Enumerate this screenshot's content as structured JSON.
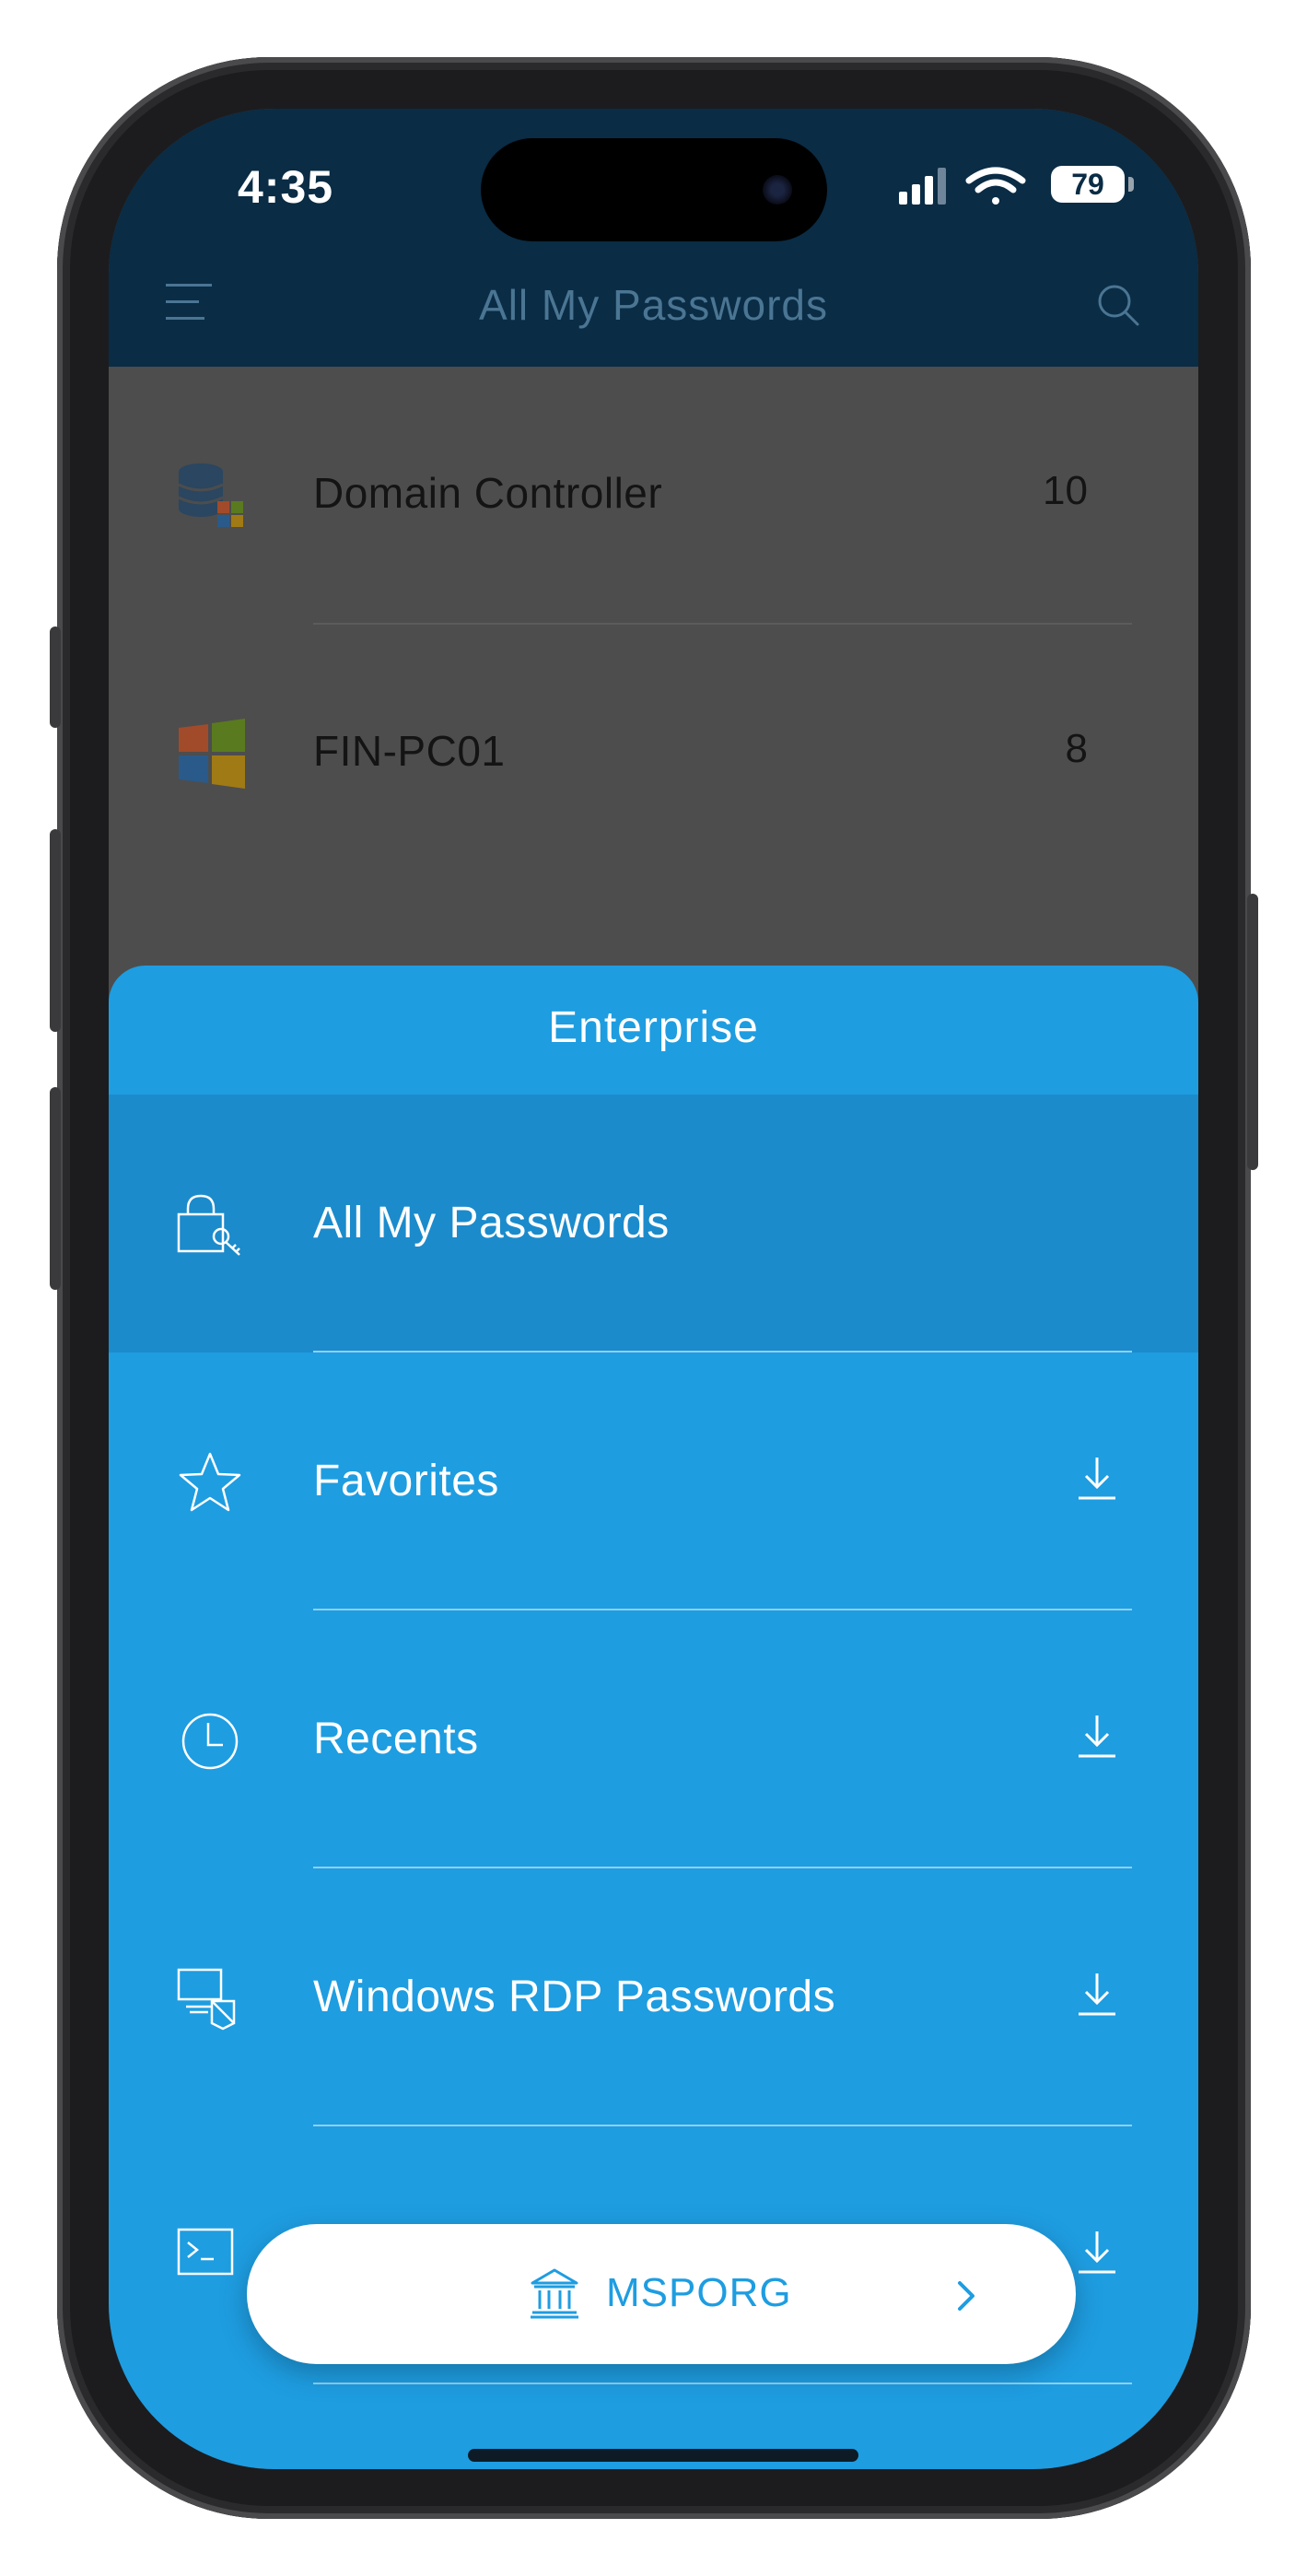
{
  "status_bar": {
    "time": "4:35",
    "battery": "79"
  },
  "nav": {
    "title": "All My Passwords"
  },
  "background_list": [
    {
      "label": "Domain Controller",
      "count": "10",
      "icon": "database-windows-icon"
    },
    {
      "label": "FIN-PC01",
      "count": "8",
      "icon": "windows-logo-icon"
    }
  ],
  "sheet": {
    "title": "Enterprise",
    "items": [
      {
        "label": "All My Passwords",
        "icon": "lock-key-icon",
        "active": true
      },
      {
        "label": "Favorites",
        "icon": "star-icon",
        "download": true
      },
      {
        "label": "Recents",
        "icon": "clock-icon",
        "download": true
      },
      {
        "label": "Windows RDP Passwords",
        "icon": "rdp-monitor-icon",
        "download": true
      },
      {
        "label": "",
        "icon": "terminal-icon",
        "download": true
      }
    ]
  },
  "org": {
    "name": "MSPORG"
  },
  "colors": {
    "header_bg": "#0a2c45",
    "sheet_bg": "#1e9de1",
    "active_row": "#1b8bcc",
    "dim_overlay": "#4d4d4d"
  }
}
